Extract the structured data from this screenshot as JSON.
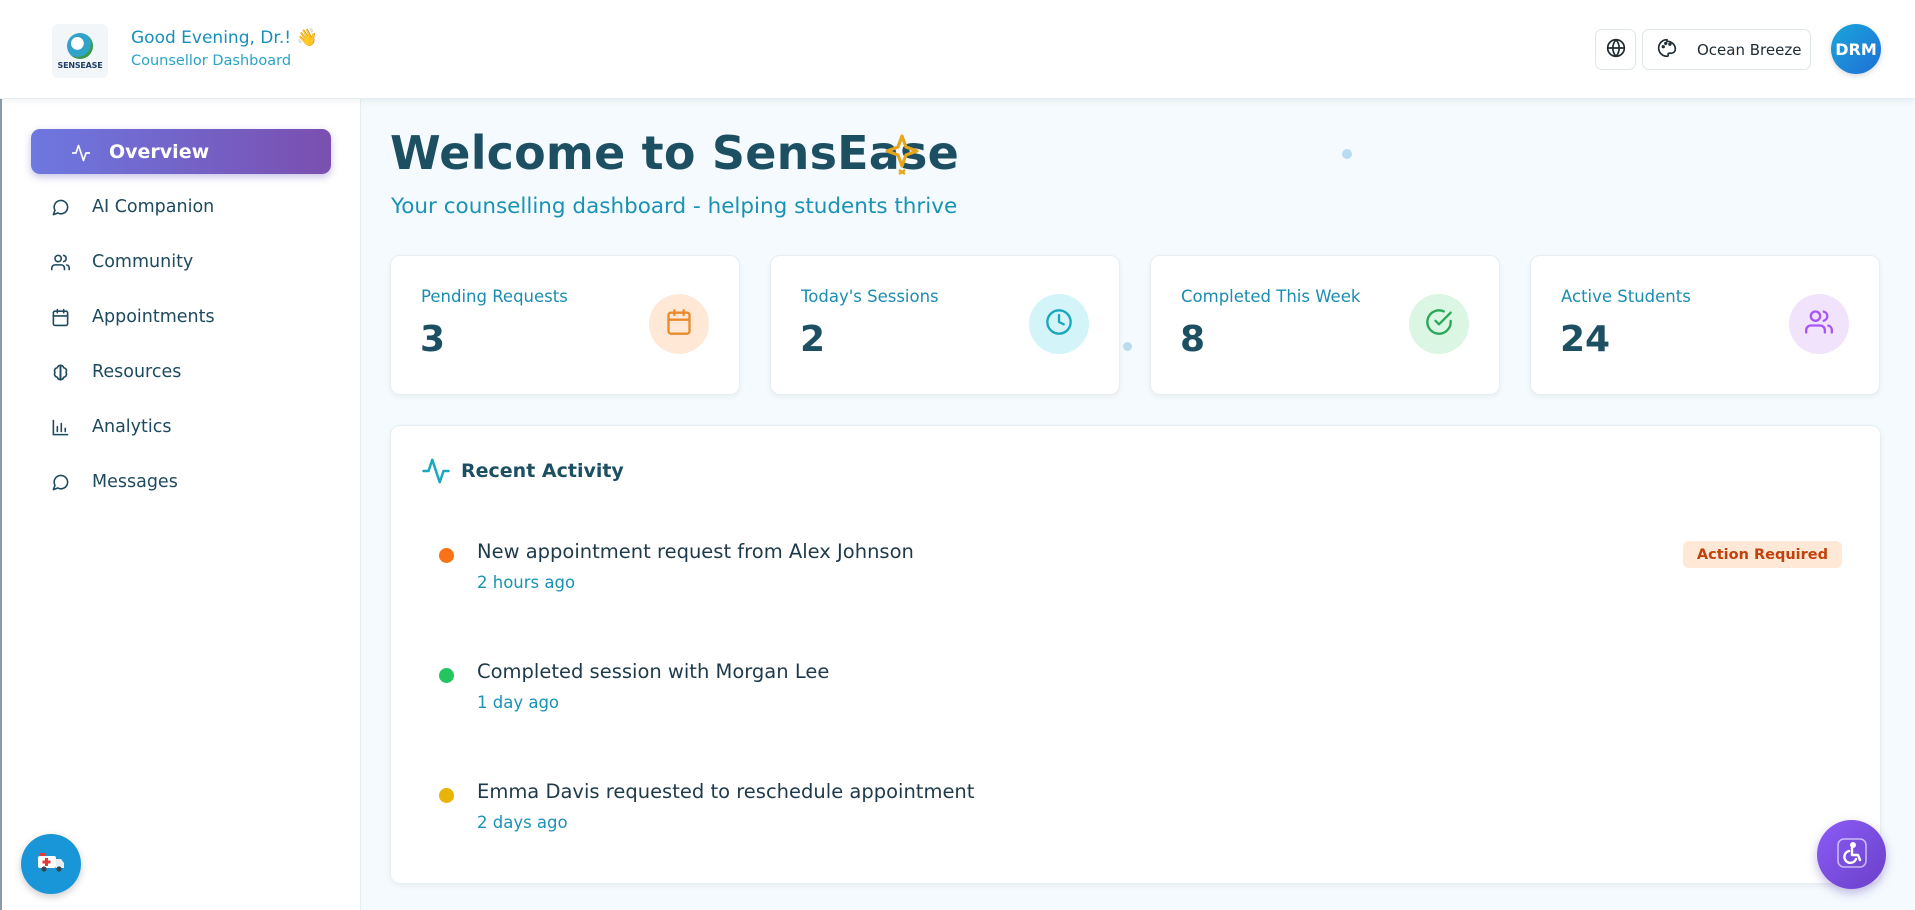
{
  "header": {
    "logo_text": "SENSEASE",
    "greeting": "Good Evening, Dr.! 👋",
    "subtitle": "Counsellor Dashboard",
    "language_icon": "globe-icon",
    "theme_icon": "palette-icon",
    "theme_label": "Ocean Breeze",
    "avatar_initials": "DRM"
  },
  "sidebar": {
    "items": [
      {
        "label": "Overview",
        "icon": "activity-icon",
        "active": true
      },
      {
        "label": "AI Companion",
        "icon": "chat-bubble-icon"
      },
      {
        "label": "Community",
        "icon": "users-icon"
      },
      {
        "label": "Appointments",
        "icon": "calendar-icon"
      },
      {
        "label": "Resources",
        "icon": "brain-icon"
      },
      {
        "label": "Analytics",
        "icon": "bar-chart-icon"
      },
      {
        "label": "Messages",
        "icon": "chat-bubble-icon"
      }
    ],
    "emergency_icon": "ambulance-icon"
  },
  "main": {
    "welcome": "Welcome to SensEase",
    "tagline": "Your counselling dashboard - helping students thrive",
    "stats": [
      {
        "label": "Pending Requests",
        "value": "3",
        "icon": "calendar-icon",
        "color": "#ea8a2e",
        "bg": "#ffe9d6"
      },
      {
        "label": "Today's Sessions",
        "value": "2",
        "icon": "clock-icon",
        "color": "#1aa8c0",
        "bg": "#d3f4f8"
      },
      {
        "label": "Completed This Week",
        "value": "8",
        "icon": "check-circle-icon",
        "color": "#2aa85a",
        "bg": "#dcf6e4"
      },
      {
        "label": "Active Students",
        "value": "24",
        "icon": "users-icon",
        "color": "#a855f7",
        "bg": "#f1e3fb"
      }
    ],
    "activity": {
      "title": "Recent Activity",
      "items": [
        {
          "message": "New appointment request from Alex Johnson",
          "time": "2 hours ago",
          "dot_color": "#f97316",
          "tag": "Action Required"
        },
        {
          "message": "Completed session with Morgan Lee",
          "time": "1 day ago",
          "dot_color": "#22c55e"
        },
        {
          "message": "Emma Davis requested to reschedule appointment",
          "time": "2 days ago",
          "dot_color": "#eab308"
        }
      ]
    }
  },
  "accessibility_icon": "wheelchair-icon"
}
